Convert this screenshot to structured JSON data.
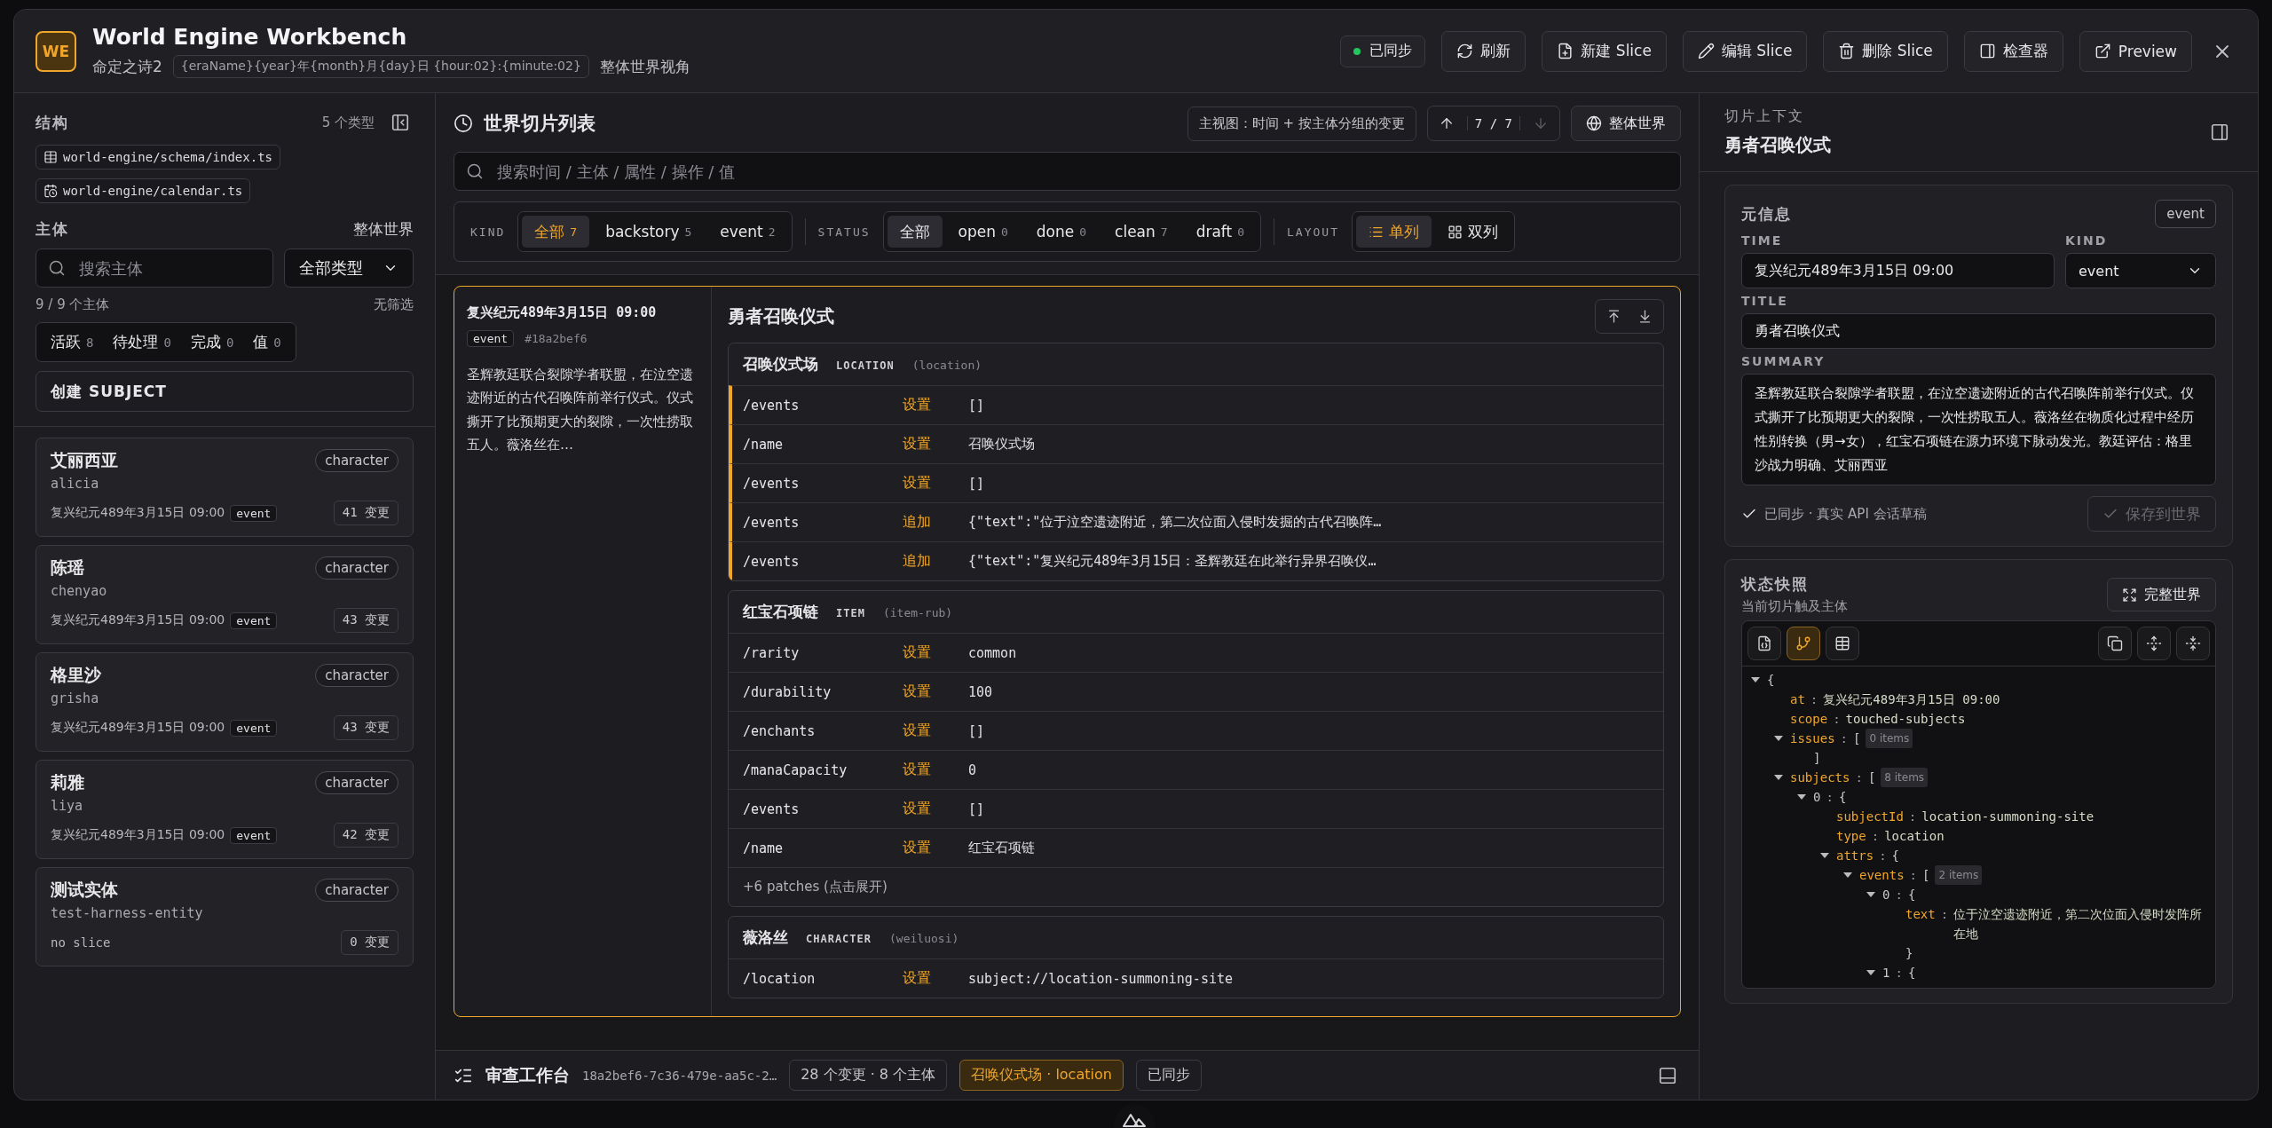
{
  "header": {
    "logo": "WE",
    "title": "World Engine Workbench",
    "project": "命定之诗2",
    "time_format": "{eraName}{year}年{month}月{day}日 {hour:02}:{minute:02}",
    "view": "整体世界视角",
    "sync": "已同步",
    "buttons": [
      "刷新",
      "新建 Slice",
      "编辑 Slice",
      "删除 Slice",
      "检查器",
      "Preview"
    ]
  },
  "sidebar": {
    "structure_title": "结构",
    "type_count": "5 个类型",
    "files": [
      "world-engine/schema/index.ts",
      "world-engine/calendar.ts"
    ],
    "subjects_title": "主体",
    "scope": "整体世界",
    "search": {
      "placeholder": "搜索主体"
    },
    "type_select": "全部类型",
    "subject_count": "9 / 9 个主体",
    "filter_note": "无筛选",
    "status_chips": [
      {
        "label": "活跃",
        "count": "8"
      },
      {
        "label": "待处理",
        "count": "0"
      },
      {
        "label": "完成",
        "count": "0"
      },
      {
        "label": "值",
        "count": "0"
      }
    ],
    "create_button": "创建 SUBJECT",
    "subjects": [
      {
        "name": "艾丽西亚",
        "id": "alicia",
        "type": "character",
        "time": "复兴纪元489年3月15日 09:00",
        "kind": "event",
        "changes": "41 变更"
      },
      {
        "name": "陈瑶",
        "id": "chenyao",
        "type": "character",
        "time": "复兴纪元489年3月15日 09:00",
        "kind": "event",
        "changes": "43 变更"
      },
      {
        "name": "格里沙",
        "id": "grisha",
        "type": "character",
        "time": "复兴纪元489年3月15日 09:00",
        "kind": "event",
        "changes": "43 变更"
      },
      {
        "name": "莉雅",
        "id": "liya",
        "type": "character",
        "time": "复兴纪元489年3月15日 09:00",
        "kind": "event",
        "changes": "42 变更"
      },
      {
        "name": "测试实体",
        "id": "test-harness-entity",
        "type": "character",
        "time": "no slice",
        "changes": "0 变更"
      }
    ]
  },
  "slices": {
    "title": "世界切片列表",
    "view_note": "主视图：时间 + 按主体分组的变更",
    "pager": {
      "label": "7 / 7",
      "up_disabled": false,
      "down_disabled": true
    },
    "scope_button": "整体世界",
    "search": {
      "placeholder": "搜索时间 / 主体 / 属性 / 操作 / 值"
    },
    "filter_groups": [
      {
        "label": "KIND",
        "options": [
          {
            "label": "全部",
            "count": "7",
            "selected": true
          },
          {
            "label": "backstory",
            "count": "5",
            "selected": false
          },
          {
            "label": "event",
            "count": "2",
            "selected": false
          }
        ]
      },
      {
        "label": "STATUS",
        "options": [
          {
            "label": "全部",
            "selected": true
          },
          {
            "label": "open",
            "count": "0",
            "selected": false
          },
          {
            "label": "done",
            "count": "0",
            "selected": false
          },
          {
            "label": "clean",
            "count": "7",
            "selected": false
          },
          {
            "label": "draft",
            "count": "0",
            "selected": false
          }
        ]
      },
      {
        "label": "LAYOUT",
        "options": [
          {
            "label": "单列",
            "selected": true
          },
          {
            "label": "双列",
            "selected": false
          }
        ]
      }
    ],
    "card": {
      "time": "复兴纪元489年3月15日 09:00",
      "kind": "event",
      "id": "#18a2bef6",
      "summary": "圣辉教廷联合裂隙学者联盟，在泣空遗迹附近的古代召唤阵前举行仪式。仪式撕开了比预期更大的裂隙，一次性捞取五人。薇洛丝在…",
      "title": "勇者召唤仪式",
      "groups": [
        {
          "name": "召唤仪式场",
          "type": "LOCATION",
          "id": "(location)",
          "highlighted": true,
          "patches": [
            {
              "path": "/events",
              "op": "设置",
              "value": "[]"
            },
            {
              "path": "/name",
              "op": "设置",
              "value": "召唤仪式场"
            },
            {
              "path": "/events",
              "op": "设置",
              "value": "[]"
            },
            {
              "path": "/events",
              "op": "追加",
              "value": "{\"text\":\"位于泣空遗迹附近，第二次位面入侵时发掘的古代召唤阵…"
            },
            {
              "path": "/events",
              "op": "追加",
              "value": "{\"text\":\"复兴纪元489年3月15日：圣辉教廷在此举行异界召唤仪…"
            }
          ]
        },
        {
          "name": "红宝石项链",
          "type": "ITEM",
          "id": "(item-rub)",
          "highlighted": false,
          "patches": [
            {
              "path": "/rarity",
              "op": "设置",
              "value": "common"
            },
            {
              "path": "/durability",
              "op": "设置",
              "value": "100"
            },
            {
              "path": "/enchants",
              "op": "设置",
              "value": "[]"
            },
            {
              "path": "/manaCapacity",
              "op": "设置",
              "value": "0"
            },
            {
              "path": "/events",
              "op": "设置",
              "value": "[]"
            },
            {
              "path": "/name",
              "op": "设置",
              "value": "红宝石项链"
            }
          ],
          "more": "+6 patches (点击展开)"
        },
        {
          "name": "薇洛丝",
          "type": "CHARACTER",
          "id": "(weiluosi)",
          "highlighted": false,
          "patches": [
            {
              "path": "/location",
              "op": "设置",
              "value": "subject://location-summoning-site"
            }
          ]
        }
      ]
    }
  },
  "review_bar": {
    "title": "审查工作台",
    "id": "18a2bef6-7c36-479e-aa5c-2…",
    "stats": "28 个变更 · 8 个主体",
    "focus": "召唤仪式场 · location",
    "sync": "已同步"
  },
  "inspector": {
    "caption": "切片上下文",
    "title": "勇者召唤仪式",
    "meta": {
      "title": "元信息",
      "badge": "event",
      "time_label": "TIME",
      "time": "复兴纪元489年3月15日 09:00",
      "kind_label": "KIND",
      "kind": "event",
      "title_label": "TITLE",
      "title_value": "勇者召唤仪式",
      "summary_label": "SUMMARY",
      "summary": "圣辉教廷联合裂隙学者联盟，在泣空遗迹附近的古代召唤阵前举行仪式。仪式撕开了比预期更大的裂隙，一次性捞取五人。薇洛丝在物质化过程中经历性别转换（男→女），红宝石项链在源力环境下脉动发光。教廷评估：格里沙战力明确、艾丽西亚",
      "sync": "已同步 · 真实 API 会话草稿",
      "save": {
        "label": "保存到世界",
        "disabled": true
      }
    },
    "snapshot": {
      "title": "状态快照",
      "subtitle": "当前切片触及主体",
      "button": "完整世界",
      "modes": [
        {
          "selected": false
        },
        {
          "selected": true
        },
        {
          "selected": false
        }
      ],
      "separator": ":",
      "tree": {
        "open": "{",
        "expanded": true,
        "children": [
          {
            "key": "at",
            "value": "复兴纪元489年3月15日 09:00"
          },
          {
            "key": "scope",
            "value": "touched-subjects"
          },
          {
            "key": "issues",
            "open": "[",
            "count": "0 items",
            "expanded": true,
            "close": "]"
          },
          {
            "key": "subjects",
            "open": "[",
            "count": "8 items",
            "expanded": true,
            "children": [
              {
                "key": "0",
                "open": "{",
                "expanded": true,
                "children": [
                  {
                    "key": "subjectId",
                    "value": "location-summoning-site"
                  },
                  {
                    "key": "type",
                    "value": "location"
                  },
                  {
                    "key": "attrs",
                    "open": "{",
                    "expanded": true,
                    "children": [
                      {
                        "key": "events",
                        "open": "[",
                        "count": "2 items",
                        "expanded": true,
                        "children": [
                          {
                            "key": "0",
                            "open": "{",
                            "expanded": true,
                            "close": "}",
                            "children": [
                              {
                                "key": "text",
                                "value": "位于泣空遗迹附近，第二次位面入侵时发阵所在地"
                              }
                            ]
                          },
                          {
                            "key": "1",
                            "open": "{",
                            "expanded": true
                          }
                        ]
                      }
                    ]
                  }
                ]
              }
            ]
          }
        ]
      }
    }
  }
}
